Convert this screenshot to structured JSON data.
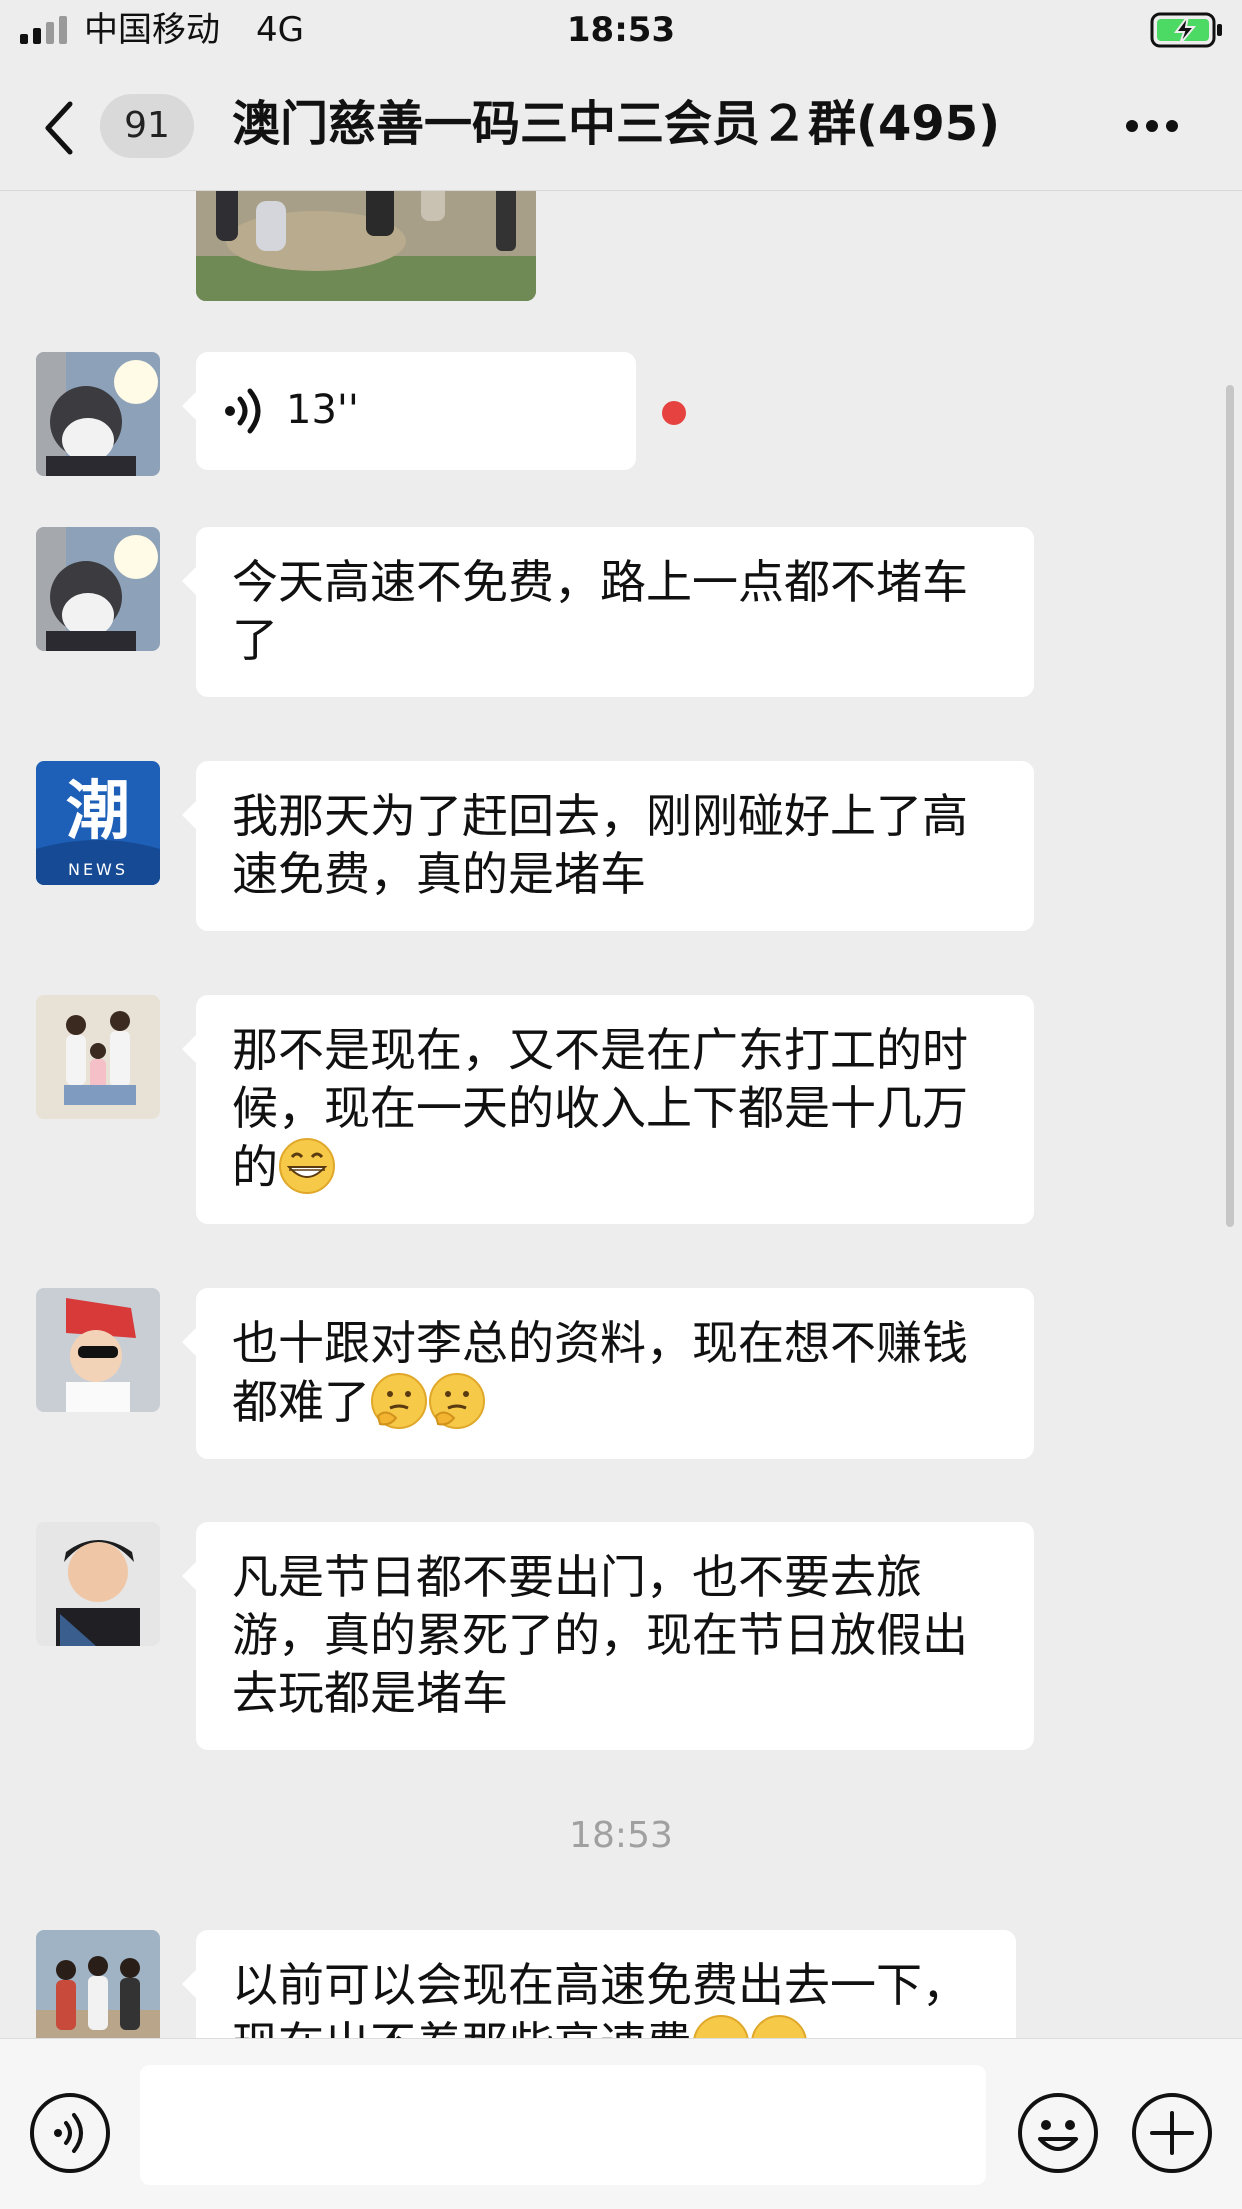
{
  "status_bar": {
    "carrier": "中国移动",
    "network": "4G",
    "time": "18:53",
    "battery_charging": true,
    "battery_color": "#4cd964"
  },
  "header": {
    "unread_count": "91",
    "title": "澳门慈善一码三中三会员２群(495)"
  },
  "messages": [
    {
      "type": "voice",
      "duration": "13''",
      "unread": true,
      "avatar": "person-avatar"
    },
    {
      "type": "text",
      "text": "今天高速不免费，路上一点都不堵车了",
      "avatar": "person-avatar"
    },
    {
      "type": "text",
      "text": "我那天为了赶回去，刚刚碰好上了高速免费，真的是堵车",
      "avatar": "news-logo-avatar"
    },
    {
      "type": "text",
      "text": "那不是现在，又不是在广东打工的时候，现在一天的收入上下都是十几万的",
      "emojis": [
        "grin-emoji"
      ],
      "avatar": "family-avatar"
    },
    {
      "type": "text",
      "text": "也十跟对李总的资料，现在想不赚钱都难了",
      "emojis": [
        "thinking-emoji",
        "thinking-emoji"
      ],
      "avatar": "child-avatar"
    },
    {
      "type": "text",
      "text": "凡是节日都不要出门，也不要去旅游，真的累死了的，现在节日放假出去玩都是堵车",
      "avatar": "selfie-avatar"
    },
    {
      "type": "text",
      "text": "以前可以会现在高速免费出去一下，现在出不着那些高速费",
      "emojis": [
        "smile-emoji",
        "smile-emoji"
      ],
      "avatar": "group-avatar"
    }
  ],
  "time_divider": "18:53",
  "avatar_labels": {
    "news_char": "潮",
    "news_text": "NEWS"
  },
  "input": {
    "placeholder": ""
  },
  "colors": {
    "background": "#ededed",
    "bubble": "#ffffff",
    "unread_dot": "#e64340",
    "news_blue": "#1e5fb8"
  }
}
